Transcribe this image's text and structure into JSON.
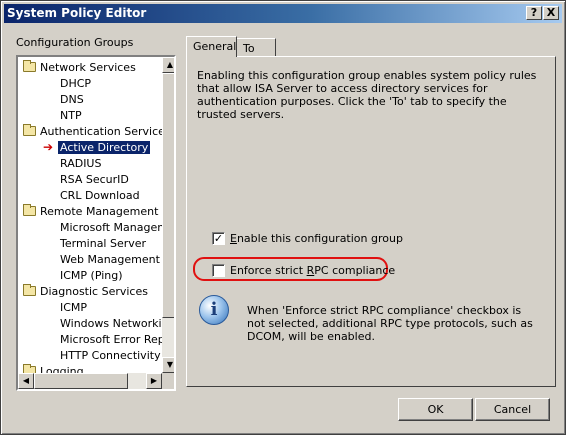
{
  "window": {
    "title": "System Policy Editor",
    "help_label": "?",
    "close_label": "X"
  },
  "groups": {
    "label": "Configuration Groups",
    "tree": [
      {
        "label": "Network Services",
        "type": "category"
      },
      {
        "label": "DHCP",
        "type": "leaf"
      },
      {
        "label": "DNS",
        "type": "leaf"
      },
      {
        "label": "NTP",
        "type": "leaf"
      },
      {
        "label": "Authentication Services",
        "type": "category"
      },
      {
        "label": "Active Directory",
        "type": "leaf",
        "selected": true
      },
      {
        "label": "RADIUS",
        "type": "leaf"
      },
      {
        "label": "RSA SecurID",
        "type": "leaf"
      },
      {
        "label": "CRL Download",
        "type": "leaf"
      },
      {
        "label": "Remote Management",
        "type": "category"
      },
      {
        "label": "Microsoft Manageme",
        "type": "leaf"
      },
      {
        "label": "Terminal Server",
        "type": "leaf"
      },
      {
        "label": "Web Management",
        "type": "leaf"
      },
      {
        "label": "ICMP (Ping)",
        "type": "leaf"
      },
      {
        "label": "Diagnostic Services",
        "type": "category"
      },
      {
        "label": "ICMP",
        "type": "leaf"
      },
      {
        "label": "Windows Networking",
        "type": "leaf"
      },
      {
        "label": "Microsoft Error Repo",
        "type": "leaf"
      },
      {
        "label": "HTTP Connectivity ve",
        "type": "leaf"
      },
      {
        "label": "Logging",
        "type": "category"
      }
    ]
  },
  "tabs": {
    "general": "General",
    "to": "To"
  },
  "panel": {
    "description": "Enabling this configuration group enables system policy rules that allow ISA Server to access directory services for authentication purposes. Click the 'To' tab to specify the trusted servers.",
    "enable_checkbox": {
      "label_pre": "",
      "label_key": "E",
      "label_post": "nable this configuration group",
      "checked": true
    },
    "strict_checkbox": {
      "label_pre": "Enforce strict ",
      "label_key": "R",
      "label_post": "PC compliance",
      "checked": false
    },
    "info_text": "When 'Enforce strict RPC compliance' checkbox is not selected, additional RPC type protocols, such as DCOM, will be enabled.",
    "info_icon_glyph": "i"
  },
  "buttons": {
    "ok": "OK",
    "cancel": "Cancel"
  },
  "colors": {
    "selection": "#0a246a",
    "highlight_ring": "#e01010",
    "arrow": "#cc0000"
  }
}
